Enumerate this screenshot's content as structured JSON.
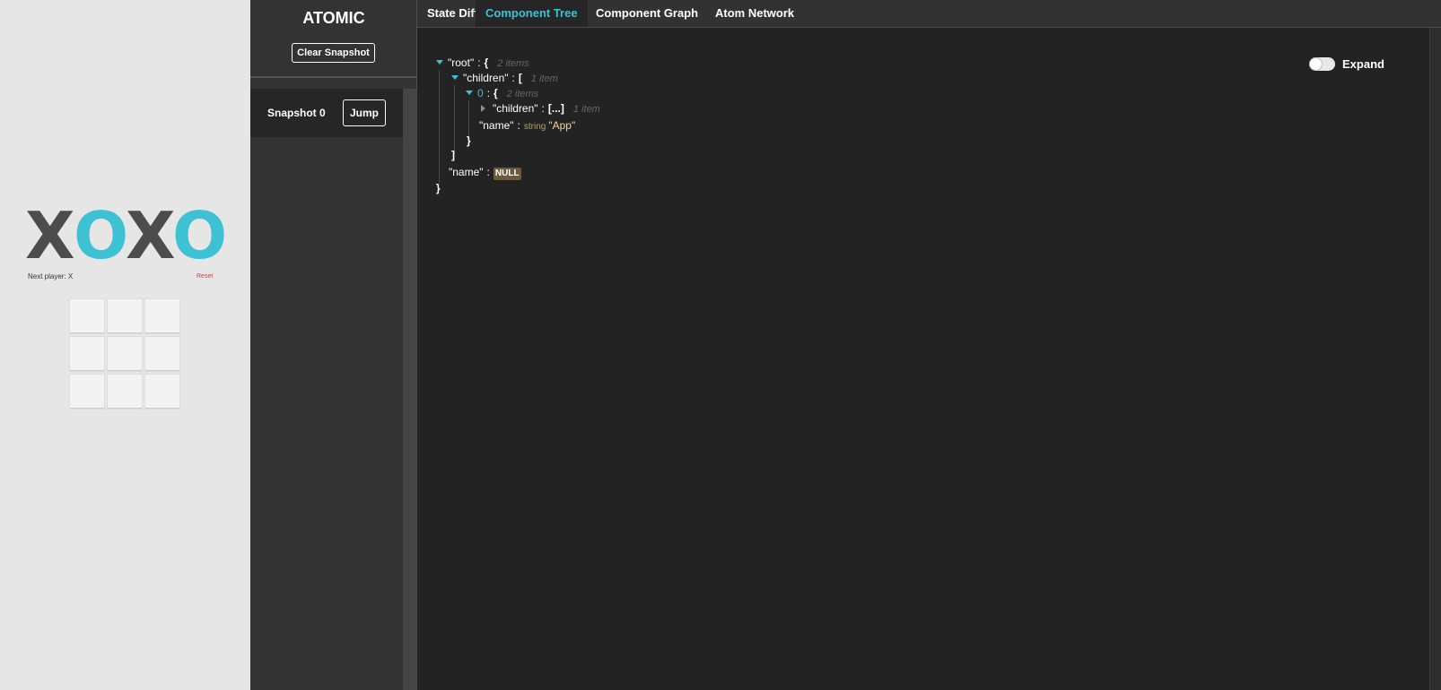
{
  "app": {
    "logo": {
      "letters": [
        "X",
        "O",
        "X",
        "O"
      ]
    },
    "next_player": "Next player: X",
    "reset_link": "Reset",
    "board": {
      "cells": [
        "",
        "",
        "",
        "",
        "",
        "",
        "",
        "",
        ""
      ]
    }
  },
  "sidebar": {
    "brand": "ATOMIC",
    "clear_button": "Clear Snapshot",
    "snapshots": [
      {
        "label": "Snapshot 0",
        "jump_label": "Jump"
      }
    ]
  },
  "tabs": [
    {
      "label": "State Diff",
      "active": false
    },
    {
      "label": "Component Tree",
      "active": true
    },
    {
      "label": "Component Graph",
      "active": false
    },
    {
      "label": "Atom Network",
      "active": false
    }
  ],
  "expand_toggle": {
    "label": "Expand",
    "on": false
  },
  "tree": {
    "root_key": "\"root\"",
    "root_open": "{",
    "root_meta": "2 items",
    "children_key": "\"children\"",
    "children_open": "[",
    "children_meta": "1 item",
    "index_key": "0",
    "index_open": "{",
    "index_meta": "2 items",
    "nested_children_key": "\"children\"",
    "nested_children_collapsed": "[...]",
    "nested_children_meta": "1 item",
    "inner_name_key": "\"name\"",
    "inner_name_type": "string",
    "inner_name_value": "\"App\"",
    "index_close": "}",
    "children_close": "]",
    "root_name_key": "\"name\"",
    "root_name_value": "NULL",
    "root_close": "}",
    "colon": ":"
  },
  "colors": {
    "accent": "#3ec1d3",
    "logo_x": "#4c4c4c",
    "panel_bg": "#232323",
    "sidebar_bg": "#333333",
    "null_badge": "#6b5a3f"
  }
}
